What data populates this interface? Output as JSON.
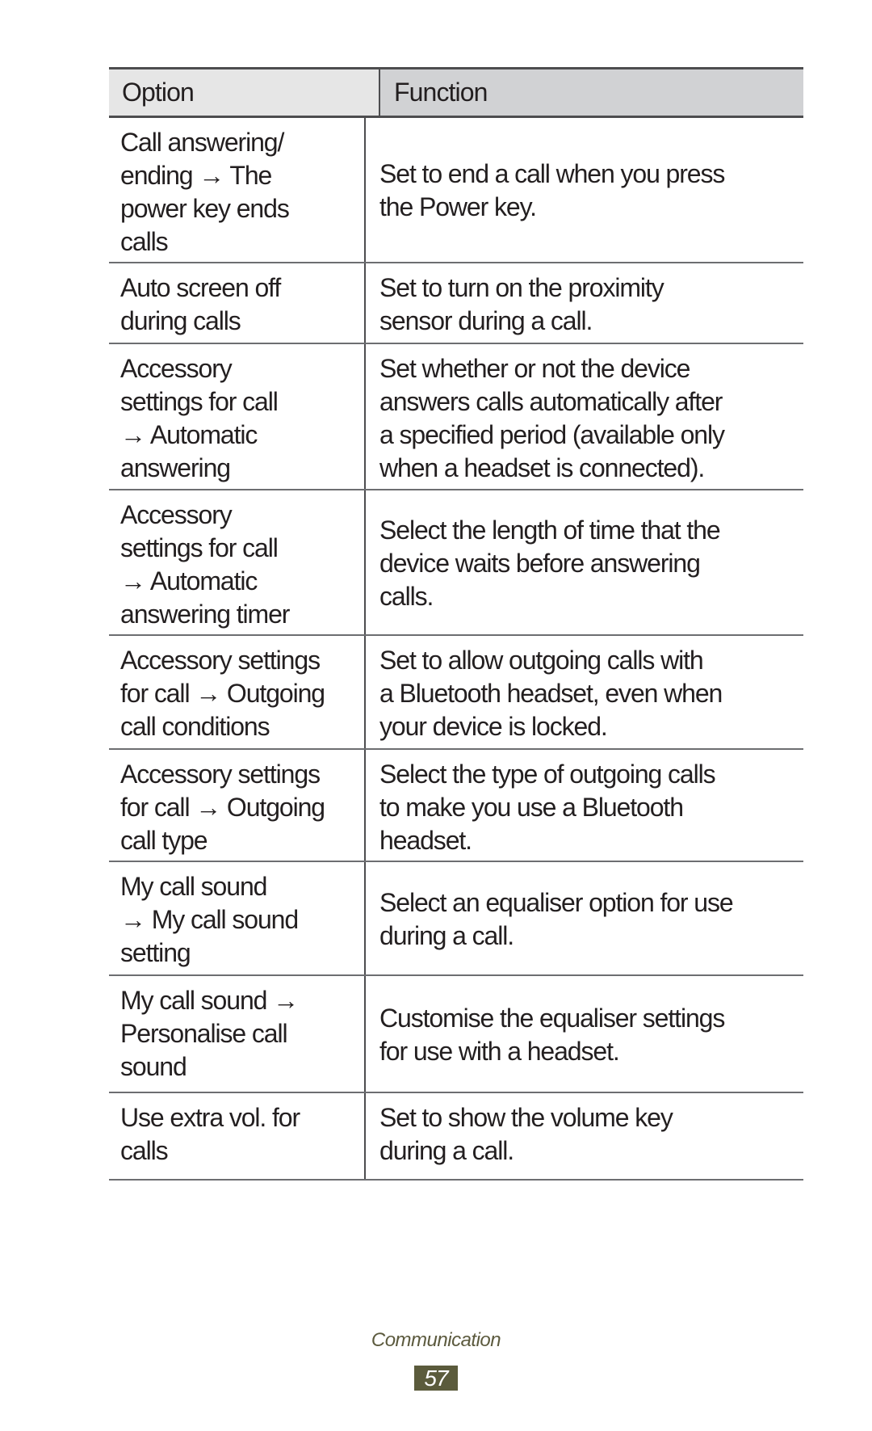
{
  "table": {
    "headers": {
      "option": "Option",
      "function": "Function"
    },
    "rows": [
      {
        "option": "Call answering/\nending → The\npower key ends\ncalls",
        "function": "Set to end a call when you press\nthe Power key."
      },
      {
        "option": "Auto screen off\nduring calls",
        "function": "Set to turn on the proximity\nsensor during a call."
      },
      {
        "option": "Accessory\nsettings for call\n→ Automatic\nanswering",
        "function": "Set whether or not the device\nanswers calls automatically after\na specified period (available only\nwhen a headset is connected)."
      },
      {
        "option": "Accessory\nsettings for call\n→ Automatic\nanswering timer",
        "function": "Select the length of time that the\ndevice waits before answering\ncalls."
      },
      {
        "option": "Accessory settings\nfor call → Outgoing\ncall conditions",
        "function": "Set to allow outgoing calls with\na Bluetooth headset, even when\nyour device is locked."
      },
      {
        "option": "Accessory settings\nfor call → Outgoing\ncall type",
        "function": "Select the type of outgoing calls\nto make you use a Bluetooth\nheadset."
      },
      {
        "option": "My call sound\n→ My call sound\nsetting",
        "function": "Select an equaliser option for use\nduring a call."
      },
      {
        "option": "My call sound →\nPersonalise call\nsound",
        "function": "Customise the equaliser settings\nfor use with a headset."
      },
      {
        "option": "Use extra vol. for\ncalls",
        "function": "Set to show the volume key\nduring a call."
      }
    ]
  },
  "footer": {
    "section": "Communication",
    "page_number": "57"
  },
  "colors": {
    "header_option_bg": "#e6e6e6",
    "header_function_bg": "#d1d2d4",
    "footer_accent": "#5b5b3c"
  }
}
